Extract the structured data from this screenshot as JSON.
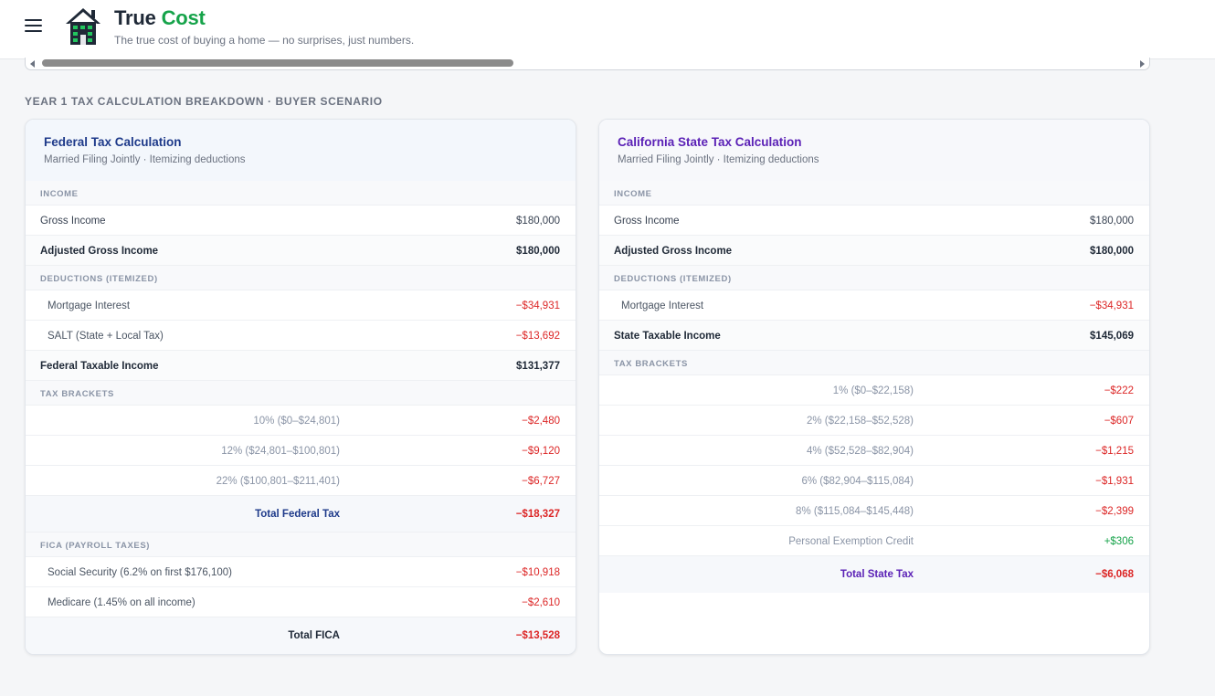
{
  "header": {
    "title_main": "True",
    "title_accent": "Cost",
    "tagline": "The true cost of buying a home — no surprises, just numbers."
  },
  "section_title": "YEAR 1 TAX CALCULATION BREAKDOWN · BUYER SCENARIO",
  "federal": {
    "title": "Federal Tax Calculation",
    "subtitle": "Married Filing Jointly · Itemizing deductions",
    "income_label": "INCOME",
    "gross_income_label": "Gross Income",
    "gross_income": "$180,000",
    "agi_label": "Adjusted Gross Income",
    "agi": "$180,000",
    "deductions_label": "DEDUCTIONS (ITEMIZED)",
    "mortgage_interest_label": "Mortgage Interest",
    "mortgage_interest": "−$34,931",
    "salt_label": "SALT (State + Local Tax)",
    "salt": "−$13,692",
    "taxable_label": "Federal Taxable Income",
    "taxable": "$131,377",
    "brackets_label": "TAX BRACKETS",
    "brackets": [
      {
        "label": "10% ($0–$24,801)",
        "value": "−$2,480"
      },
      {
        "label": "12% ($24,801–$100,801)",
        "value": "−$9,120"
      },
      {
        "label": "22% ($100,801–$211,401)",
        "value": "−$6,727"
      }
    ],
    "total_tax_label": "Total Federal Tax",
    "total_tax": "−$18,327",
    "fica_label": "FICA (PAYROLL TAXES)",
    "ss_label": "Social Security (6.2% on first $176,100)",
    "ss": "−$10,918",
    "medicare_label": "Medicare (1.45% on all income)",
    "medicare": "−$2,610",
    "total_fica_label": "Total FICA",
    "total_fica": "−$13,528"
  },
  "state": {
    "title": "California State Tax Calculation",
    "subtitle": "Married Filing Jointly · Itemizing deductions",
    "income_label": "INCOME",
    "gross_income_label": "Gross Income",
    "gross_income": "$180,000",
    "agi_label": "Adjusted Gross Income",
    "agi": "$180,000",
    "deductions_label": "DEDUCTIONS (ITEMIZED)",
    "mortgage_interest_label": "Mortgage Interest",
    "mortgage_interest": "−$34,931",
    "taxable_label": "State Taxable Income",
    "taxable": "$145,069",
    "brackets_label": "TAX BRACKETS",
    "brackets": [
      {
        "label": "1% ($0–$22,158)",
        "value": "−$222"
      },
      {
        "label": "2% ($22,158–$52,528)",
        "value": "−$607"
      },
      {
        "label": "4% ($52,528–$82,904)",
        "value": "−$1,215"
      },
      {
        "label": "6% ($82,904–$115,084)",
        "value": "−$1,931"
      },
      {
        "label": "8% ($115,084–$145,448)",
        "value": "−$2,399"
      }
    ],
    "exemption_label": "Personal Exemption Credit",
    "exemption": "+$306",
    "total_tax_label": "Total State Tax",
    "total_tax": "−$6,068"
  },
  "colors": {
    "brand_accent": "#16a34a",
    "negative": "#dc2626",
    "positive": "#16a34a",
    "federal_title": "#1e3a8a",
    "state_title": "#5b21b6"
  }
}
